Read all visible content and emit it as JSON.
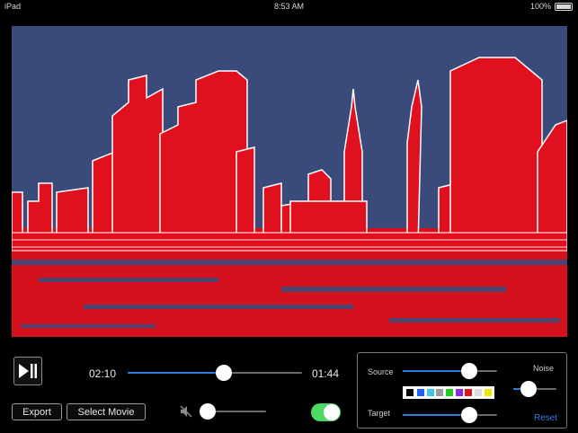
{
  "status_bar": {
    "device": "iPad",
    "time": "8:53 AM",
    "battery": "100%"
  },
  "player": {
    "current_time": "02:10",
    "remaining_time": "01:44",
    "position_fraction": 0.55,
    "volume_fraction": 0.12,
    "toggle_on": true
  },
  "buttons": {
    "export_label": "Export",
    "select_movie_label": "Select Movie"
  },
  "panel": {
    "source_label": "Source",
    "target_label": "Target",
    "noise_label": "Noise",
    "reset_label": "Reset",
    "source_fraction": 0.7,
    "target_fraction": 0.7,
    "noise_fraction": 0.35
  },
  "swatch_colors": [
    "#000000",
    "#1f5fff",
    "#39c9e6",
    "#9b9b9b",
    "#22cc22",
    "#8a2be2",
    "#e01515",
    "#dddddd",
    "#f2e600"
  ],
  "colors": {
    "accent": "#2a7de1",
    "toggle_green": "#4cd964",
    "video_sky": "#3a4a7a",
    "video_red": "#e0101e"
  }
}
